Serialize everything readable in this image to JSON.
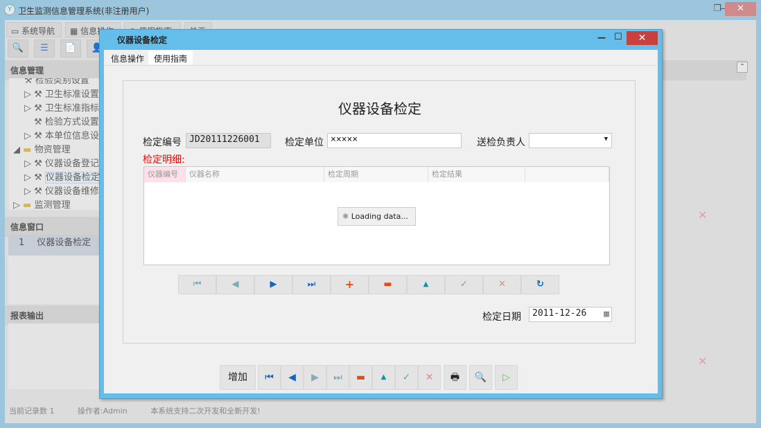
{
  "main_window": {
    "title": "卫生监测信息管理系统(非注册用户)",
    "controls": [
      "—",
      "❐",
      "✕"
    ],
    "tabs": [
      "系统导航",
      "信息操作",
      "使用指南",
      "关于"
    ],
    "info_mgmt_header": "信息管理",
    "tree": [
      {
        "label": "检验类别设置",
        "level": 2
      },
      {
        "label": "卫生标准设置",
        "level": 2
      },
      {
        "label": "卫生标准指标",
        "level": 2
      },
      {
        "label": "检验方式设置",
        "level": 2
      },
      {
        "label": "本单位信息设",
        "level": 2
      },
      {
        "label": "物资管理",
        "level": 1,
        "expanded": true
      },
      {
        "label": "仪器设备登记",
        "level": 2
      },
      {
        "label": "仪器设备检定",
        "level": 2,
        "selected": true
      },
      {
        "label": "仪器设备维修",
        "level": 2
      },
      {
        "label": "监测管理",
        "level": 1
      }
    ],
    "info_window_header": "信息窗口",
    "info_window_rows": [
      {
        "num": "1",
        "name": "仪器设备检定"
      }
    ],
    "report_header": "报表输出",
    "status": {
      "records": "当前记录数 1",
      "operator": "操作者:Admin",
      "note": "本系统支持二次开发和全新开发!"
    }
  },
  "dialog": {
    "title": "仪器设备检定",
    "close": "✕",
    "min": "—",
    "max": "☐",
    "tabs": [
      "信息操作",
      "使用指南"
    ],
    "form_title": "仪器设备检定",
    "fields": {
      "code_label": "检定编号",
      "code_value": "JD20111226001",
      "unit_label": "检定单位",
      "unit_value": "×××××",
      "person_label": "送检负责人",
      "person_value": "",
      "date_label": "检定日期",
      "date_value": "2011-12-26"
    },
    "detail_label": "检定明细:",
    "grid_columns": [
      "仪器编号",
      "仪器名称",
      "检定周期",
      "检定结果"
    ],
    "loading": "Loading data...",
    "grid_nav": [
      "first",
      "prev",
      "next",
      "last",
      "add",
      "delete",
      "edit",
      "post",
      "cancel",
      "refresh"
    ],
    "bottom": {
      "add_label": "增加",
      "buttons": [
        "first",
        "prev",
        "next",
        "last",
        "delete",
        "edit",
        "post",
        "cancel",
        "print",
        "preview",
        "run"
      ]
    }
  },
  "colors": {
    "dialog_frame": "#65bde9",
    "close": "#c9413f",
    "detail_label": "#ff0000"
  }
}
